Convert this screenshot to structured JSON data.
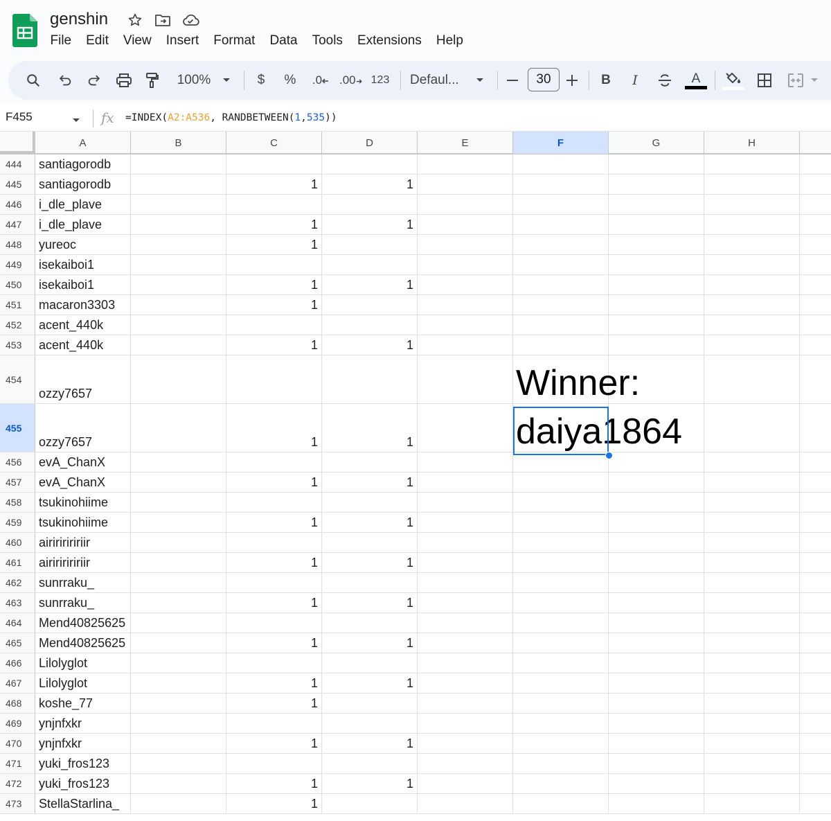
{
  "doc": {
    "title": "genshin"
  },
  "menu": [
    "File",
    "Edit",
    "View",
    "Insert",
    "Format",
    "Data",
    "Tools",
    "Extensions",
    "Help"
  ],
  "toolbar": {
    "zoom": "100%",
    "currency": "$",
    "percent": "%",
    "decimal_decrease": ".0",
    "decimal_increase": ".00",
    "number_format": "123",
    "font": "Defaul...",
    "font_size": "30",
    "bold": "B",
    "italic": "I",
    "text_color_letter": "A"
  },
  "formula_bar": {
    "cell_ref": "F455",
    "formula_prefix": "=INDEX(",
    "formula_range": "A2:A536",
    "formula_middle": ", RANDBETWEEN(",
    "formula_arg1": "1",
    "formula_comma": ",",
    "formula_arg2": "535",
    "formula_suffix": "))"
  },
  "columns": [
    "A",
    "B",
    "C",
    "D",
    "E",
    "F",
    "G",
    "H"
  ],
  "selected_column": "F",
  "selected_row": "455",
  "rows": [
    {
      "num": "444",
      "a": "santiagorodb",
      "c": "",
      "d": ""
    },
    {
      "num": "445",
      "a": "santiagorodb",
      "c": "1",
      "d": "1"
    },
    {
      "num": "446",
      "a": "i_dle_plave",
      "c": "",
      "d": ""
    },
    {
      "num": "447",
      "a": "i_dle_plave",
      "c": "1",
      "d": "1"
    },
    {
      "num": "448",
      "a": "yureoc",
      "c": "1",
      "d": ""
    },
    {
      "num": "449",
      "a": "isekaiboi1",
      "c": "",
      "d": ""
    },
    {
      "num": "450",
      "a": "isekaiboi1",
      "c": "1",
      "d": "1"
    },
    {
      "num": "451",
      "a": "macaron3303",
      "c": "1",
      "d": ""
    },
    {
      "num": "452",
      "a": "acent_440k",
      "c": "",
      "d": ""
    },
    {
      "num": "453",
      "a": "acent_440k",
      "c": "1",
      "d": "1"
    },
    {
      "num": "454",
      "a": "ozzy7657",
      "c": "",
      "d": "",
      "tall": true
    },
    {
      "num": "455",
      "a": "ozzy7657",
      "c": "1",
      "d": "1",
      "tall": true
    },
    {
      "num": "456",
      "a": "evA_ChanX",
      "c": "",
      "d": ""
    },
    {
      "num": "457",
      "a": "evA_ChanX",
      "c": "1",
      "d": "1"
    },
    {
      "num": "458",
      "a": "tsukinohiime",
      "c": "",
      "d": ""
    },
    {
      "num": "459",
      "a": "tsukinohiime",
      "c": "1",
      "d": "1"
    },
    {
      "num": "460",
      "a": "airiririririir",
      "c": "",
      "d": ""
    },
    {
      "num": "461",
      "a": "airiririririir",
      "c": "1",
      "d": "1"
    },
    {
      "num": "462",
      "a": "sunrraku_",
      "c": "",
      "d": ""
    },
    {
      "num": "463",
      "a": "sunrraku_",
      "c": "1",
      "d": "1"
    },
    {
      "num": "464",
      "a": "Mend40825625",
      "c": "",
      "d": ""
    },
    {
      "num": "465",
      "a": "Mend40825625",
      "c": "1",
      "d": "1"
    },
    {
      "num": "466",
      "a": "Lilolyglot",
      "c": "",
      "d": ""
    },
    {
      "num": "467",
      "a": "Lilolyglot",
      "c": "1",
      "d": "1"
    },
    {
      "num": "468",
      "a": "koshe_77",
      "c": "1",
      "d": ""
    },
    {
      "num": "469",
      "a": "ynjnfxkr",
      "c": "",
      "d": ""
    },
    {
      "num": "470",
      "a": "ynjnfxkr",
      "c": "1",
      "d": "1"
    },
    {
      "num": "471",
      "a": "yuki_fros123",
      "c": "",
      "d": ""
    },
    {
      "num": "472",
      "a": "yuki_fros123",
      "c": "1",
      "d": "1"
    },
    {
      "num": "473",
      "a": "StellaStarlina_",
      "c": "1",
      "d": ""
    }
  ],
  "winner": {
    "label": "Winner:",
    "value": "daiya1864"
  }
}
